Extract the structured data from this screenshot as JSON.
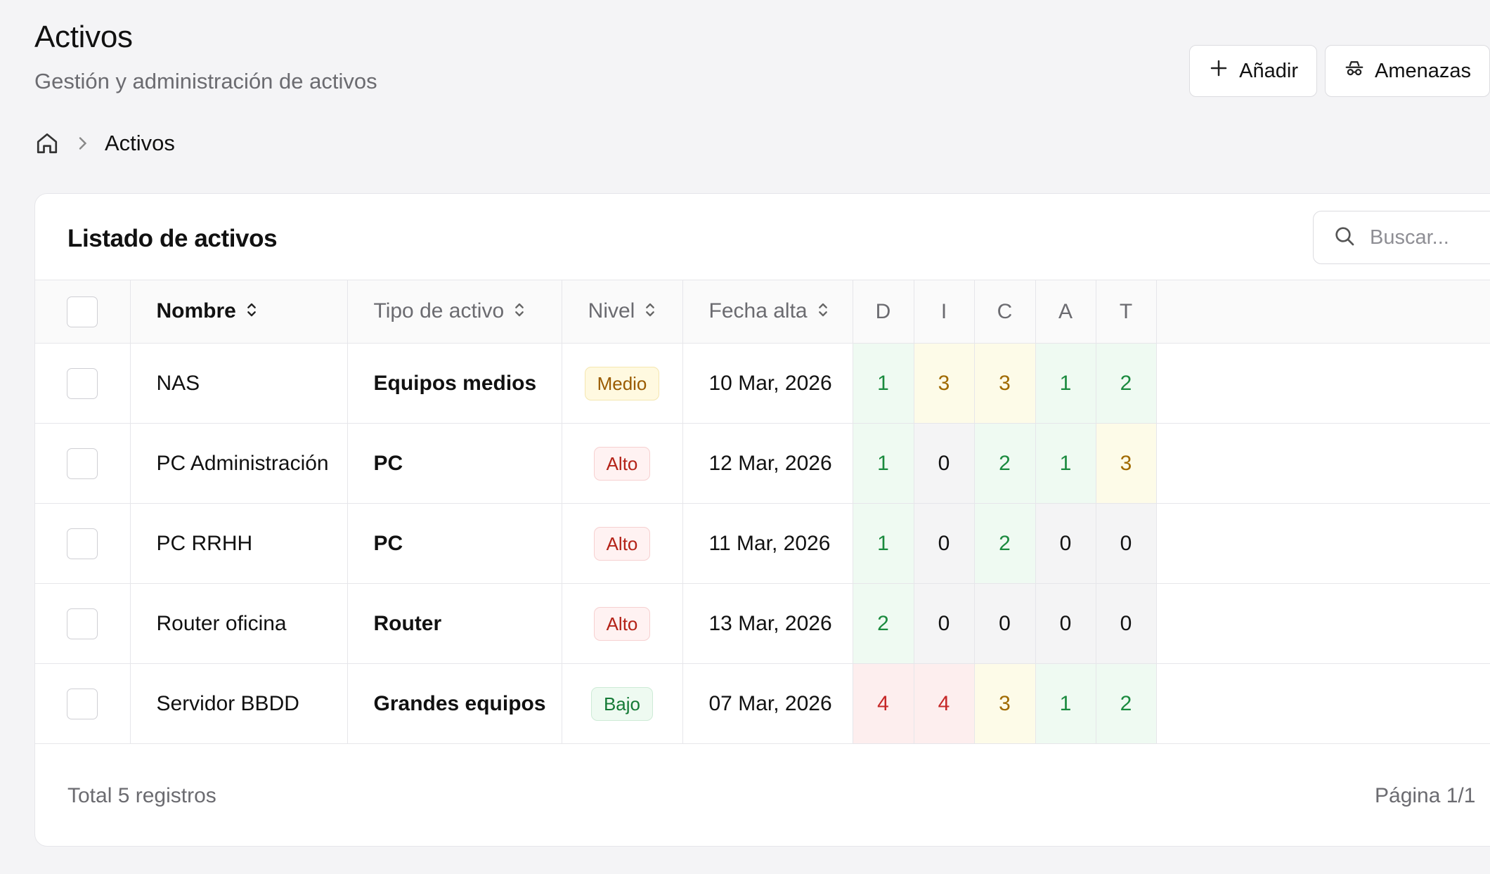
{
  "header": {
    "title": "Activos",
    "subtitle": "Gestión y administración de activos",
    "add_label": "Añadir",
    "threats_label": "Amenazas"
  },
  "breadcrumb": {
    "current": "Activos"
  },
  "card": {
    "title": "Listado de activos",
    "search_placeholder": "Buscar..."
  },
  "table": {
    "columns": {
      "name": "Nombre",
      "type": "Tipo de activo",
      "level": "Nivel",
      "date": "Fecha alta",
      "d": "D",
      "i": "I",
      "c": "C",
      "a": "A",
      "t": "T"
    },
    "rows": [
      {
        "name": "NAS",
        "type": "Equipos medios",
        "level": "Medio",
        "date": "10 Mar, 2026",
        "d": "1",
        "i": "3",
        "c": "3",
        "a": "1",
        "t": "2"
      },
      {
        "name": "PC Administración",
        "type": "PC",
        "level": "Alto",
        "date": "12 Mar, 2026",
        "d": "1",
        "i": "0",
        "c": "2",
        "a": "1",
        "t": "3"
      },
      {
        "name": "PC RRHH",
        "type": "PC",
        "level": "Alto",
        "date": "11 Mar, 2026",
        "d": "1",
        "i": "0",
        "c": "2",
        "a": "0",
        "t": "0"
      },
      {
        "name": "Router oficina",
        "type": "Router",
        "level": "Alto",
        "date": "13 Mar, 2026",
        "d": "2",
        "i": "0",
        "c": "0",
        "a": "0",
        "t": "0"
      },
      {
        "name": "Servidor BBDD",
        "type": "Grandes equipos",
        "level": "Bajo",
        "date": "07 Mar, 2026",
        "d": "4",
        "i": "4",
        "c": "3",
        "a": "1",
        "t": "2"
      }
    ]
  },
  "footer": {
    "total": "Total 5 registros",
    "page": "Página 1/1"
  },
  "colors": {
    "level_medio": {
      "text": "#9a5b00",
      "bg": "#fff9e0",
      "border": "#f4e6b0"
    },
    "level_alto": {
      "text": "#b42318",
      "bg": "#fff2f2",
      "border": "#f6d0d0"
    },
    "level_bajo": {
      "text": "#157a36",
      "bg": "#eefaf1",
      "border": "#cdebd6"
    },
    "score_green": {
      "text": "#1a8a3e",
      "bg": "#effaf2"
    },
    "score_yellow": {
      "text": "#a06a00",
      "bg": "#fdfbe8"
    },
    "score_red": {
      "text": "#c62828",
      "bg": "#fdeeee"
    },
    "score_zero": {
      "text": "#111111",
      "bg": "#f4f4f5"
    }
  }
}
